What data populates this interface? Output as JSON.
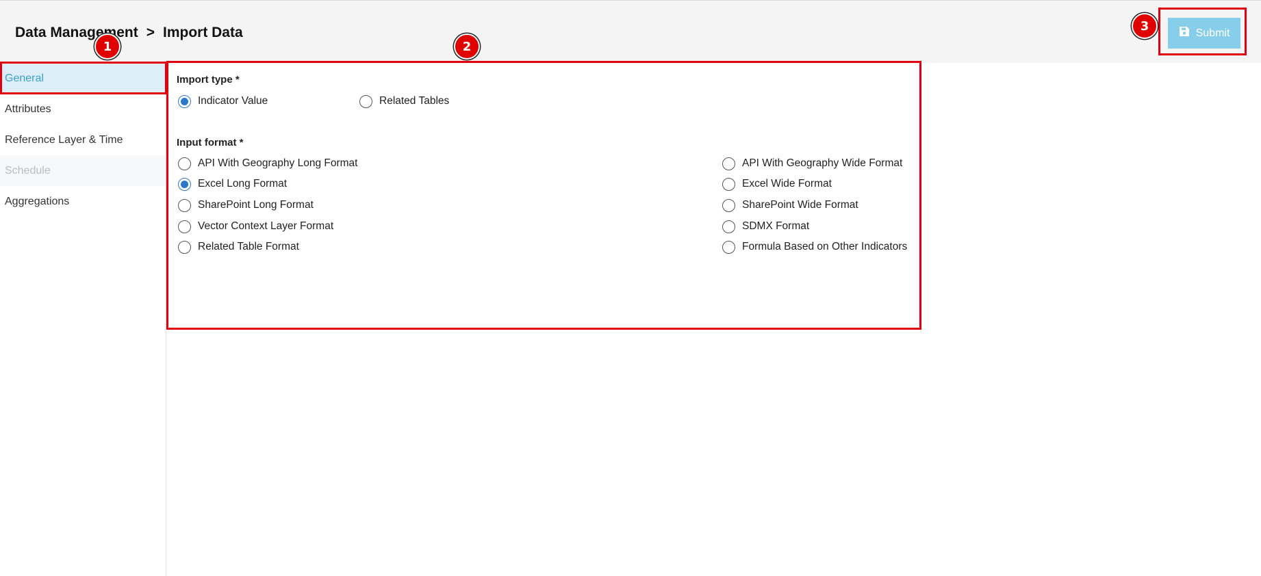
{
  "header": {
    "breadcrumb": [
      "Data Management",
      ">",
      "Import Data"
    ],
    "submit_label": "Submit",
    "submit_icon": "floppy-disk-icon",
    "submit_color": "#87ceeb"
  },
  "sidebar": {
    "items": [
      {
        "label": "General",
        "state": "active"
      },
      {
        "label": "Attributes",
        "state": "normal"
      },
      {
        "label": "Reference Layer & Time",
        "state": "normal"
      },
      {
        "label": "Schedule",
        "state": "disabled"
      },
      {
        "label": "Aggregations",
        "state": "normal"
      }
    ]
  },
  "import_type": {
    "label": "Import type *",
    "options": [
      {
        "label": "Indicator Value",
        "checked": true
      },
      {
        "label": "Related Tables",
        "checked": false
      }
    ]
  },
  "input_format": {
    "label": "Input format *",
    "left": [
      {
        "label": "API With Geography Long Format",
        "checked": false
      },
      {
        "label": "Excel Long Format",
        "checked": true
      },
      {
        "label": "SharePoint Long Format",
        "checked": false
      },
      {
        "label": "Vector Context Layer Format",
        "checked": false
      },
      {
        "label": "Related Table Format",
        "checked": false
      }
    ],
    "right": [
      {
        "label": "API With Geography Wide Format",
        "checked": false
      },
      {
        "label": "Excel Wide Format",
        "checked": false
      },
      {
        "label": "SharePoint Wide Format",
        "checked": false
      },
      {
        "label": "SDMX Format",
        "checked": false
      },
      {
        "label": "Formula Based on Other Indicators",
        "checked": false
      }
    ]
  },
  "annotations": {
    "markers": [
      "1",
      "2",
      "3"
    ],
    "color": "#e00010"
  }
}
